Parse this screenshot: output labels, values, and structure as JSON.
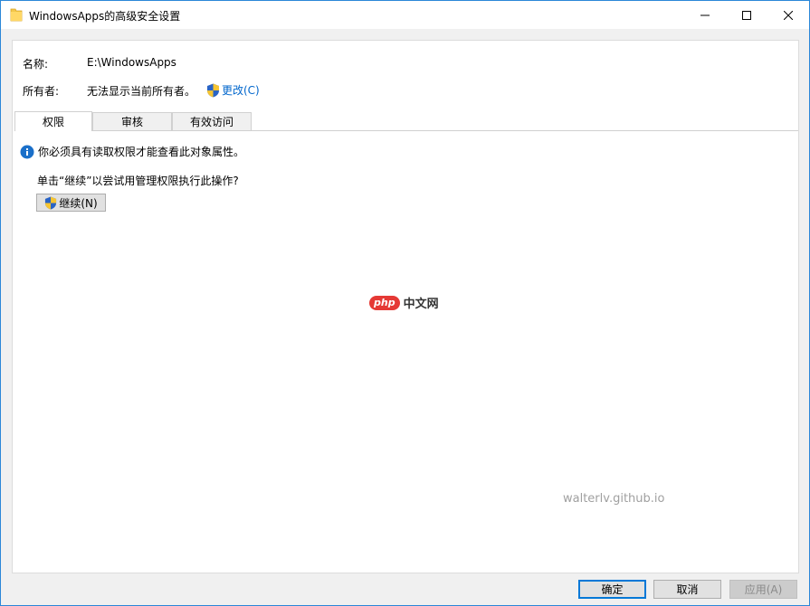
{
  "window": {
    "title": "WindowsApps的高级安全设置",
    "controls": {
      "minimize": "minimize-icon",
      "maximize": "maximize-icon",
      "close": "close-icon"
    }
  },
  "fields": {
    "name_label": "名称:",
    "name_value": "E:\\WindowsApps",
    "owner_label": "所有者:",
    "owner_value": "无法显示当前所有者。",
    "change_link": "更改(C)"
  },
  "tabs": [
    {
      "label": "权限",
      "active": true
    },
    {
      "label": "审核",
      "active": false
    },
    {
      "label": "有效访问",
      "active": false
    }
  ],
  "content": {
    "info_message": "你必须具有读取权限才能查看此对象属性。",
    "prompt": "单击“继续”以尝试用管理权限执行此操作?",
    "continue_button": "继续(N)"
  },
  "watermarks": {
    "php_badge": "php",
    "php_text": "中文网",
    "github": "walterlv.github.io"
  },
  "footer": {
    "ok": "确定",
    "cancel": "取消",
    "apply": "应用(A)"
  },
  "colors": {
    "accent": "#0078d7",
    "link": "#0066cc",
    "info_icon": "#1a6fc9"
  }
}
